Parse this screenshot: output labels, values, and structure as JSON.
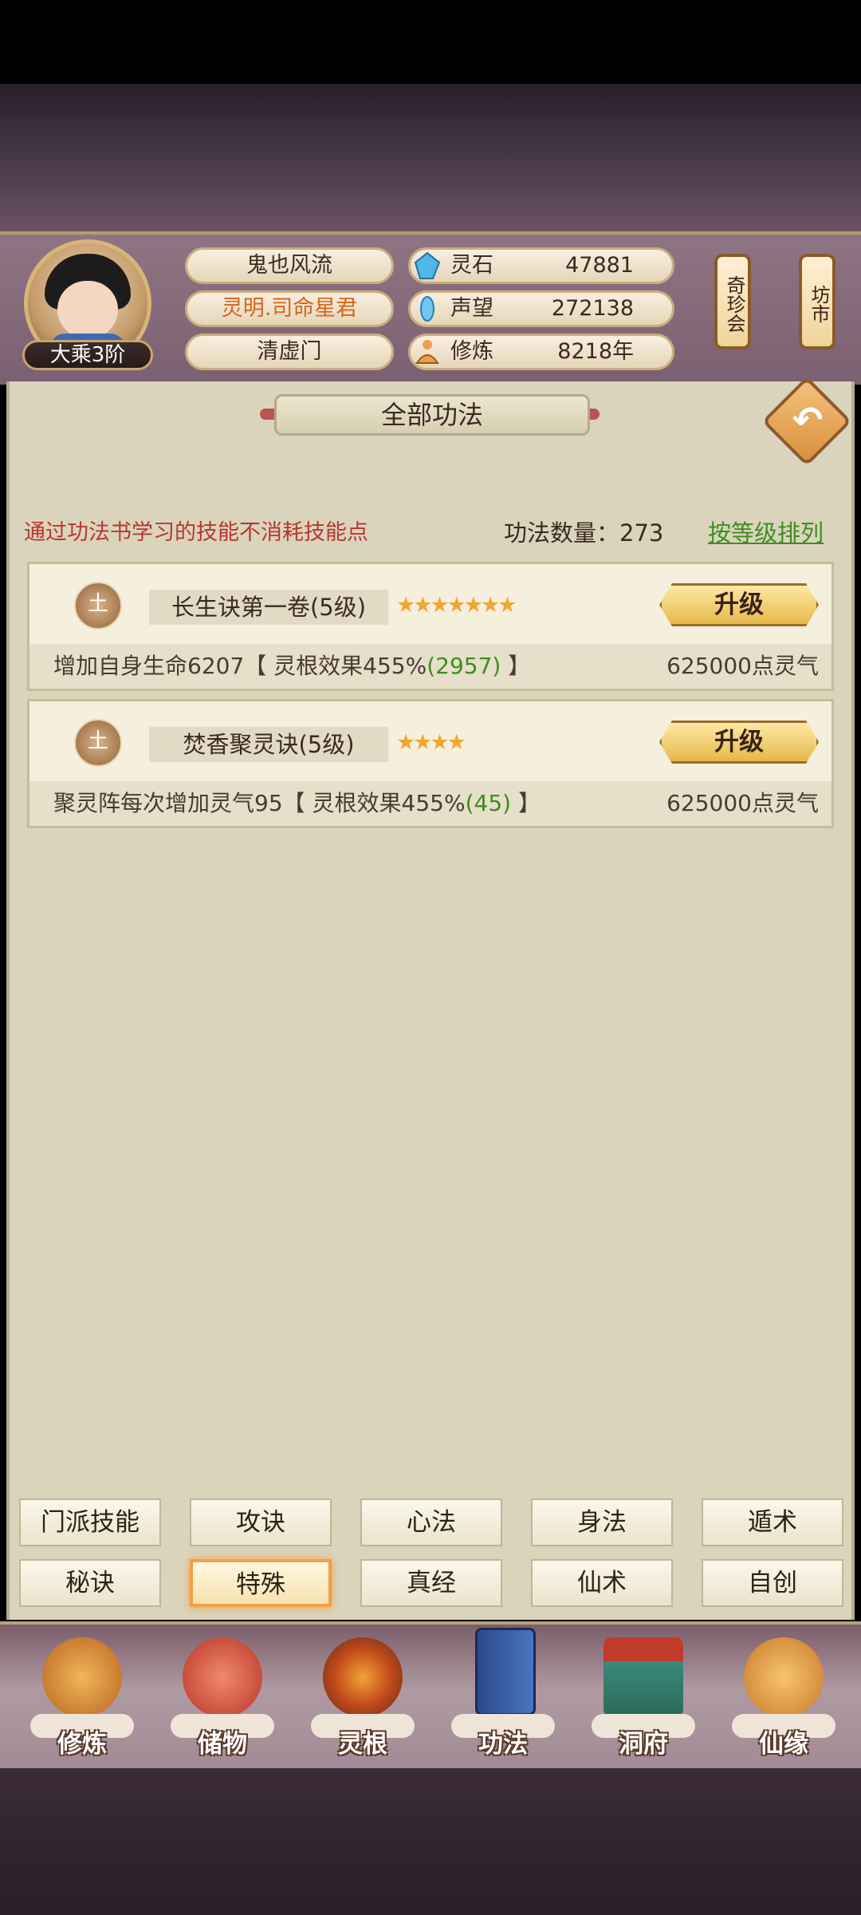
{
  "player": {
    "rank": "大乘3阶",
    "name": "鬼也风流",
    "title": "灵明.司命星君",
    "sect": "清虚门"
  },
  "stats": [
    {
      "icon": "spirit-stone-icon",
      "label": "灵石",
      "value": "47881"
    },
    {
      "icon": "prestige-icon",
      "label": "声望",
      "value": "272138"
    },
    {
      "icon": "cultivation-icon",
      "label": "修炼",
      "value": "8218年"
    }
  ],
  "lanterns": {
    "treasure_fair": "奇珍会",
    "market": "坊市"
  },
  "panel": {
    "title": "全部功法",
    "notice": "通过功法书学习的技能不消耗技能点",
    "count_label": "功法数量：273",
    "sort_link": "按等级排列"
  },
  "skills": [
    {
      "element": "土",
      "name": "长生诀第一卷(5级)",
      "stars": "★★★★★★★",
      "upgrade_label": "升级",
      "effect_prefix": "增加自身生命6207【 灵根效果455%",
      "effect_bonus": "(2957)",
      "effect_suffix": " 】",
      "cost": "625000点灵气"
    },
    {
      "element": "土",
      "name": "焚香聚灵诀(5级)",
      "stars": "★★★★",
      "upgrade_label": "升级",
      "effect_prefix": "聚灵阵每次增加灵气95【 灵根效果455%",
      "effect_bonus": "(45)",
      "effect_suffix": " 】",
      "cost": "625000点灵气"
    }
  ],
  "tabs_row1": [
    "门派技能",
    "攻诀",
    "心法",
    "身法",
    "遁术"
  ],
  "tabs_row2": [
    "秘诀",
    "特殊",
    "真经",
    "仙术",
    "自创"
  ],
  "active_tab": "特殊",
  "nav": [
    "修炼",
    "储物",
    "灵根",
    "功法",
    "洞府",
    "仙缘"
  ],
  "colors": {
    "notice_red": "#b8372e",
    "sort_green": "#3f8d1e",
    "title_orange": "#d9641b",
    "active_tab_border": "#f1a044"
  }
}
